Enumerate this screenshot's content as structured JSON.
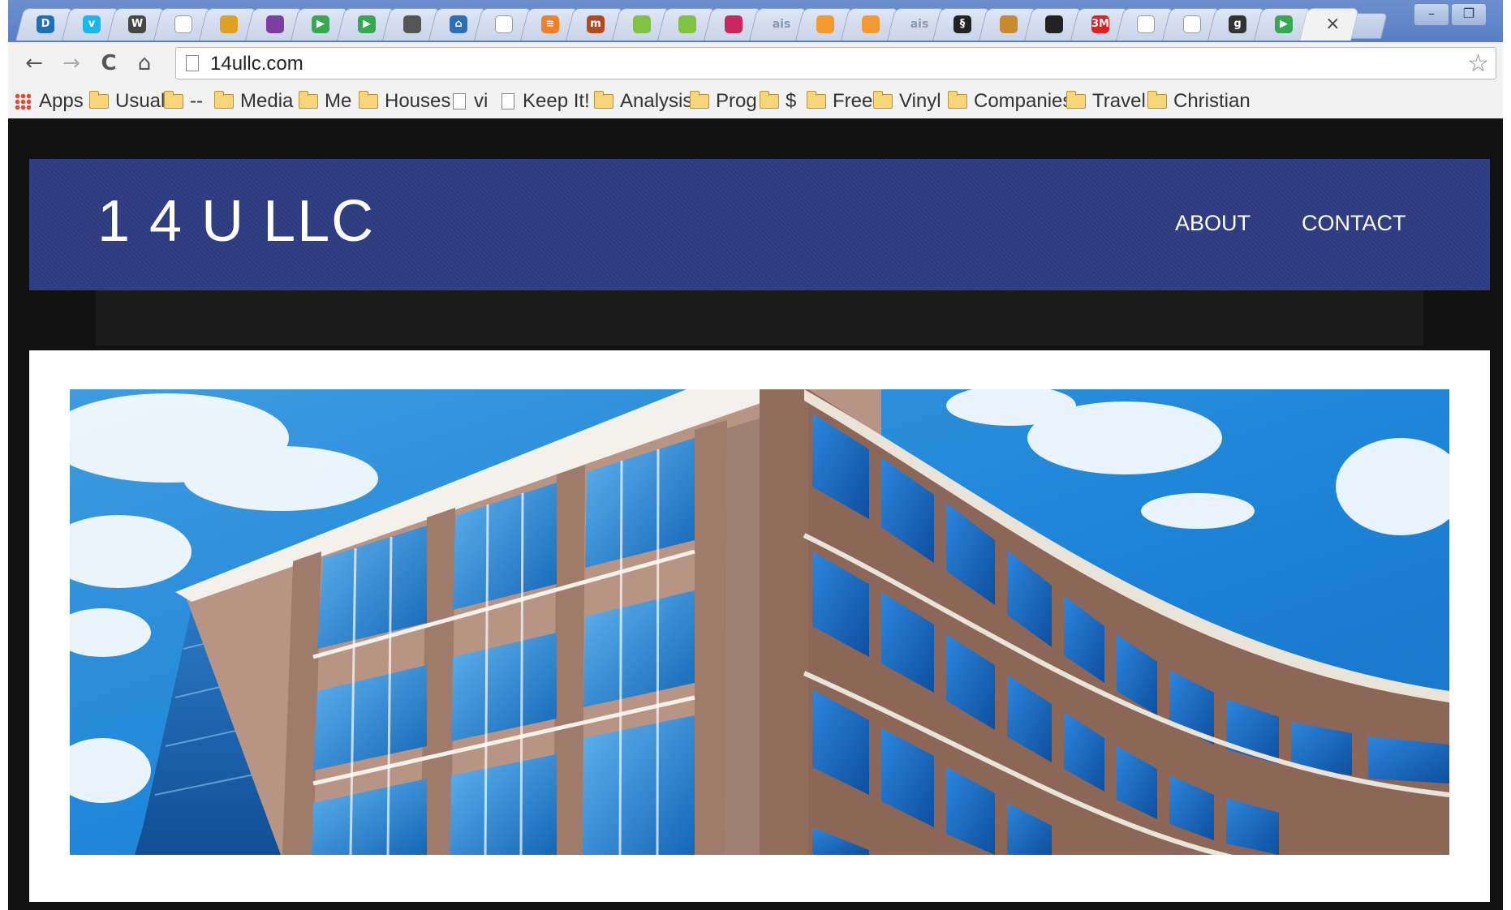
{
  "browser": {
    "tabs": [
      {
        "icon": "drupal-icon",
        "glyph": "D",
        "color": "#1b70b8"
      },
      {
        "icon": "vimeo-icon",
        "glyph": "v",
        "color": "#1ab7ea"
      },
      {
        "icon": "wordpress-icon",
        "glyph": "W",
        "color": "#464646"
      },
      {
        "icon": "document-icon",
        "glyph": "",
        "color": "#ffffff"
      },
      {
        "icon": "bars-icon",
        "glyph": "",
        "color": "#e0a020"
      },
      {
        "icon": "grid-icon",
        "glyph": "",
        "color": "#7b3fa1"
      },
      {
        "icon": "play-store-icon",
        "glyph": "▶",
        "color": "#34a853"
      },
      {
        "icon": "play-store-icon",
        "glyph": "▶",
        "color": "#34a853"
      },
      {
        "icon": "github-cat-icon",
        "glyph": "",
        "color": "#555555"
      },
      {
        "icon": "home-icon",
        "glyph": "⌂",
        "color": "#2a6fbe"
      },
      {
        "icon": "document-icon",
        "glyph": "",
        "color": "#ffffff"
      },
      {
        "icon": "stack-overflow-icon",
        "glyph": "≡",
        "color": "#f48024"
      },
      {
        "icon": "books-icon",
        "glyph": "m",
        "color": "#b34a1e"
      },
      {
        "icon": "leaf-icon",
        "glyph": "",
        "color": "#7fc241"
      },
      {
        "icon": "leaf-icon",
        "glyph": "",
        "color": "#7fc241"
      },
      {
        "icon": "feather-icon",
        "glyph": "",
        "color": "#c8265e"
      },
      {
        "icon": "ais-icon",
        "glyph": "ais",
        "color": "#8a96b4"
      },
      {
        "icon": "orange-rings-icon",
        "glyph": "",
        "color": "#f29a2e"
      },
      {
        "icon": "orange-rings-icon",
        "glyph": "",
        "color": "#f29a2e"
      },
      {
        "icon": "ais-icon",
        "glyph": "ais",
        "color": "#8a96b4"
      },
      {
        "icon": "spiral-icon",
        "glyph": "§",
        "color": "#222222"
      },
      {
        "icon": "person-icon",
        "glyph": "",
        "color": "#c98a2e"
      },
      {
        "icon": "github-icon",
        "glyph": "",
        "color": "#222222"
      },
      {
        "icon": "3m-icon",
        "glyph": "3M",
        "color": "#e02020"
      },
      {
        "icon": "blank-icon",
        "glyph": "",
        "color": "#ffffff"
      },
      {
        "icon": "document-icon",
        "glyph": "",
        "color": "#ffffff"
      },
      {
        "icon": "g-icon",
        "glyph": "g",
        "color": "#333333"
      },
      {
        "icon": "play-store-icon",
        "glyph": "▶",
        "color": "#34a853"
      }
    ],
    "active_tab_close": "×",
    "window_controls": {
      "minimize": "–",
      "restore": "❐"
    },
    "nav": {
      "back": "←",
      "forward": "→",
      "reload": "C",
      "home": "⌂"
    },
    "url": "14ullc.com",
    "star": "☆",
    "bookmarks": [
      {
        "label": "Apps",
        "kind": "apps"
      },
      {
        "label": "Usual",
        "kind": "folder"
      },
      {
        "label": "--",
        "kind": "folder"
      },
      {
        "label": "Media",
        "kind": "folder"
      },
      {
        "label": "Me",
        "kind": "folder"
      },
      {
        "label": "Houses",
        "kind": "folder"
      },
      {
        "label": "vi",
        "kind": "page"
      },
      {
        "label": "Keep It!",
        "kind": "page"
      },
      {
        "label": "Analysis",
        "kind": "folder"
      },
      {
        "label": "Prog",
        "kind": "folder"
      },
      {
        "label": "$",
        "kind": "folder"
      },
      {
        "label": "Free",
        "kind": "folder"
      },
      {
        "label": "Vinyl",
        "kind": "folder"
      },
      {
        "label": "Companies",
        "kind": "folder"
      },
      {
        "label": "Travel",
        "kind": "folder"
      },
      {
        "label": "Christian",
        "kind": "folder"
      }
    ]
  },
  "site": {
    "title": "1 4 U LLC",
    "nav": {
      "about": "ABOUT",
      "contact": "CONTACT"
    },
    "colors": {
      "header": "#2c3a7f",
      "background": "#111111",
      "content": "#ffffff"
    },
    "hero_image": "office-building-photo"
  }
}
